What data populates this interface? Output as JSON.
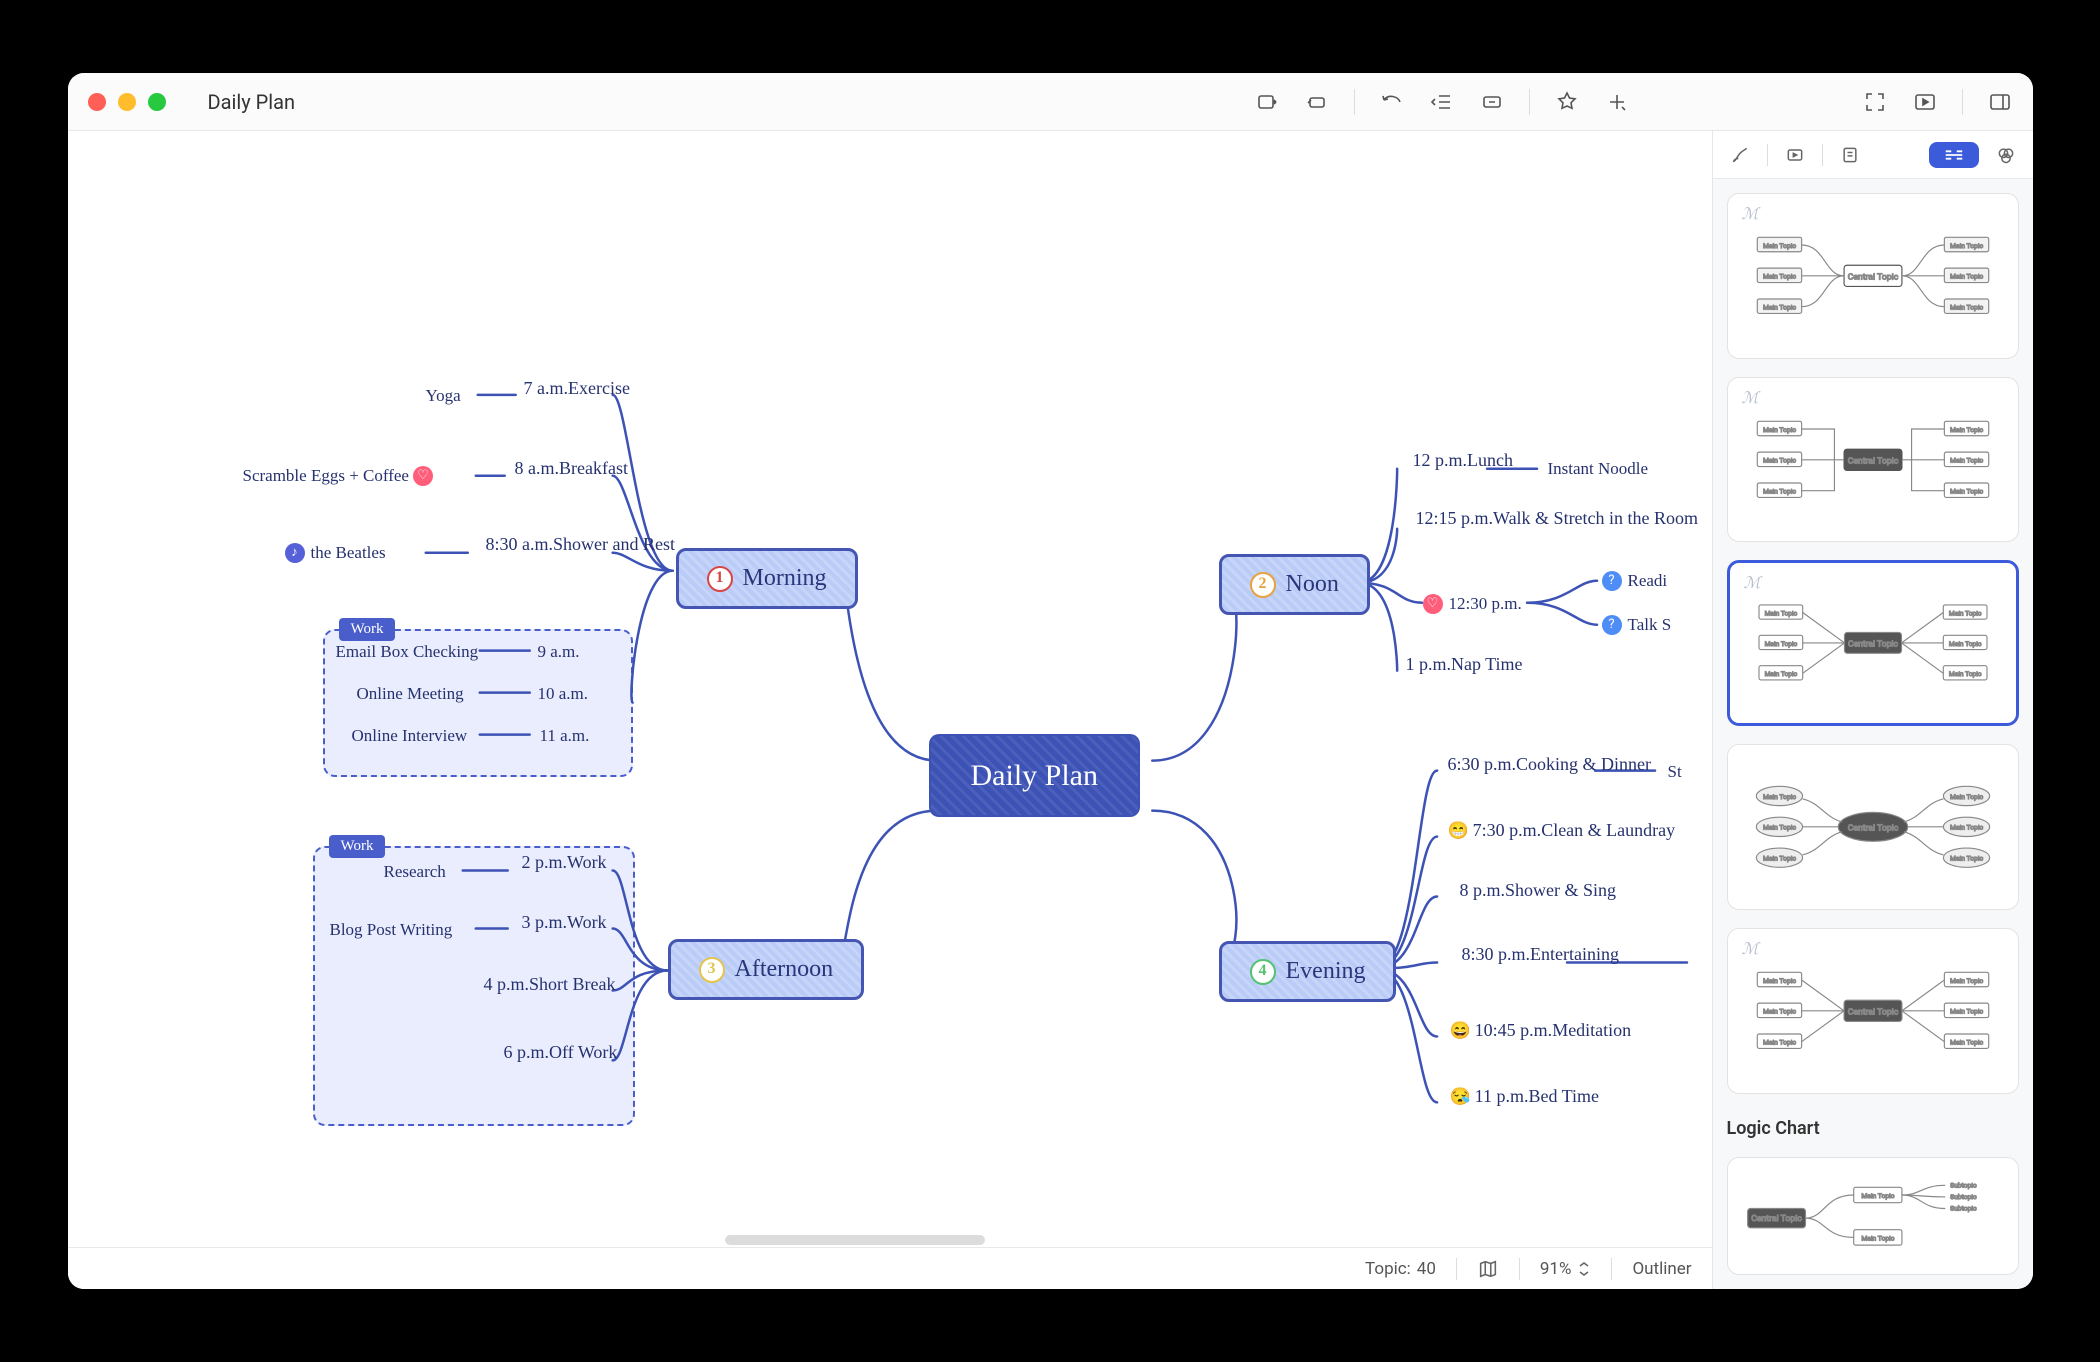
{
  "window": {
    "title": "Daily Plan"
  },
  "central": {
    "label": "Daily Plan"
  },
  "branches": {
    "morning": {
      "label": "Morning",
      "num": "1"
    },
    "afternoon": {
      "label": "Afternoon",
      "num": "3"
    },
    "noon": {
      "label": "Noon",
      "num": "2"
    },
    "evening": {
      "label": "Evening",
      "num": "4"
    }
  },
  "morning_items": [
    {
      "time": "7 a.m.",
      "label": "Exercise",
      "detail": "Yoga"
    },
    {
      "time": "8 a.m.",
      "label": "Breakfast",
      "detail": "Scramble Eggs + Coffee",
      "badge": "fav"
    },
    {
      "time": "8:30 a.m.",
      "label": "Shower and Rest",
      "detail": "the Beatles",
      "badge": "music"
    }
  ],
  "morning_work": {
    "label": "Work",
    "items": [
      {
        "label": "Email Box Checking",
        "time": "9 a.m."
      },
      {
        "label": "Online Meeting",
        "time": "10 a.m."
      },
      {
        "label": "Online Interview",
        "time": "11 a.m."
      }
    ]
  },
  "afternoon_work": {
    "label": "Work",
    "items": [
      {
        "time": "2 p.m.",
        "label": "Work",
        "detail": "Research"
      },
      {
        "time": "3 p.m.",
        "label": "Work",
        "detail": "Blog Post Writing"
      },
      {
        "time": "4 p.m.",
        "label": "Short Break"
      },
      {
        "time": "6 p.m.",
        "label": "Off Work"
      }
    ]
  },
  "noon_items": [
    {
      "time": "12 p.m.",
      "label": "Lunch",
      "detail": "Instant Noodle"
    },
    {
      "time": "12:15 p.m.",
      "label": "Walk & Stretch in the Room"
    },
    {
      "time": "12:30 p.m.",
      "detail1": "Readi",
      "detail2": "Talk S",
      "badge": "fav"
    },
    {
      "time": "1 p.m.",
      "label": "Nap Time"
    }
  ],
  "evening_items": [
    {
      "time": "6:30 p.m.",
      "label": "Cooking & Dinner",
      "detail": "St"
    },
    {
      "time": "7:30 p.m.",
      "label": "Clean & Laundray",
      "emoji": "😁"
    },
    {
      "time": "8 p.m.",
      "label": "Shower & Sing"
    },
    {
      "time": "8:30 p.m.",
      "label": "Entertaining"
    },
    {
      "time": "10:45 p.m.",
      "label": "Meditation",
      "emoji": "😄"
    },
    {
      "time": "11 p.m.",
      "label": "Bed Time",
      "emoji": "😪"
    }
  ],
  "sidebar": {
    "heading": "Logic Chart",
    "thumb_text": {
      "central": "Central Topic",
      "leaf": "Main Topic",
      "sub": "Subtopic"
    }
  },
  "status": {
    "topic_label": "Topic:",
    "topic_count": "40",
    "zoom": "91%",
    "outliner": "Outliner"
  },
  "diagram_data": {
    "type": "mindmap",
    "central": "Daily Plan",
    "branches": [
      {
        "num": 1,
        "label": "Morning",
        "side": "left",
        "children": [
          {
            "time": "7 a.m.",
            "label": "Exercise",
            "children": [
              "Yoga"
            ]
          },
          {
            "time": "8 a.m.",
            "label": "Breakfast",
            "marker": "favorite",
            "children": [
              "Scramble Eggs + Coffee"
            ]
          },
          {
            "time": "8:30 a.m.",
            "label": "Shower and Rest",
            "marker": "music",
            "children": [
              "the Beatles"
            ]
          },
          {
            "boundary": "Work",
            "children": [
              {
                "label": "Email Box Checking",
                "children": [
                  "9 a.m."
                ]
              },
              {
                "label": "Online Meeting",
                "children": [
                  "10 a.m."
                ]
              },
              {
                "label": "Online Interview",
                "children": [
                  "11 a.m."
                ]
              }
            ]
          }
        ]
      },
      {
        "num": 3,
        "label": "Afternoon",
        "side": "left",
        "boundary": "Work",
        "children": [
          {
            "time": "2 p.m.",
            "label": "Work",
            "children": [
              "Research"
            ]
          },
          {
            "time": "3 p.m.",
            "label": "Work",
            "children": [
              "Blog Post Writing"
            ]
          },
          {
            "time": "4 p.m.",
            "label": "Short Break"
          },
          {
            "time": "6 p.m.",
            "label": "Off Work"
          }
        ]
      },
      {
        "num": 2,
        "label": "Noon",
        "side": "right",
        "children": [
          {
            "time": "12 p.m.",
            "label": "Lunch",
            "children": [
              "Instant Noodle"
            ]
          },
          {
            "time": "12:15 p.m.",
            "label": "Walk & Stretch in the Room"
          },
          {
            "time": "12:30 p.m.",
            "marker": "favorite",
            "children": [
              "Reading (truncated)",
              "Talk Show (truncated)"
            ]
          },
          {
            "time": "1 p.m.",
            "label": "Nap Time"
          }
        ]
      },
      {
        "num": 4,
        "label": "Evening",
        "side": "right",
        "children": [
          {
            "time": "6:30 p.m.",
            "label": "Cooking & Dinner",
            "children": [
              "St… (truncated)"
            ]
          },
          {
            "time": "7:30 p.m.",
            "label": "Clean & Laundray",
            "emoji": "😁"
          },
          {
            "time": "8 p.m.",
            "label": "Shower & Sing"
          },
          {
            "time": "8:30 p.m.",
            "label": "Entertaining"
          },
          {
            "time": "10:45 p.m.",
            "label": "Meditation",
            "emoji": "😄"
          },
          {
            "time": "11 p.m.",
            "label": "Bed Time",
            "emoji": "😪"
          }
        ]
      }
    ]
  }
}
